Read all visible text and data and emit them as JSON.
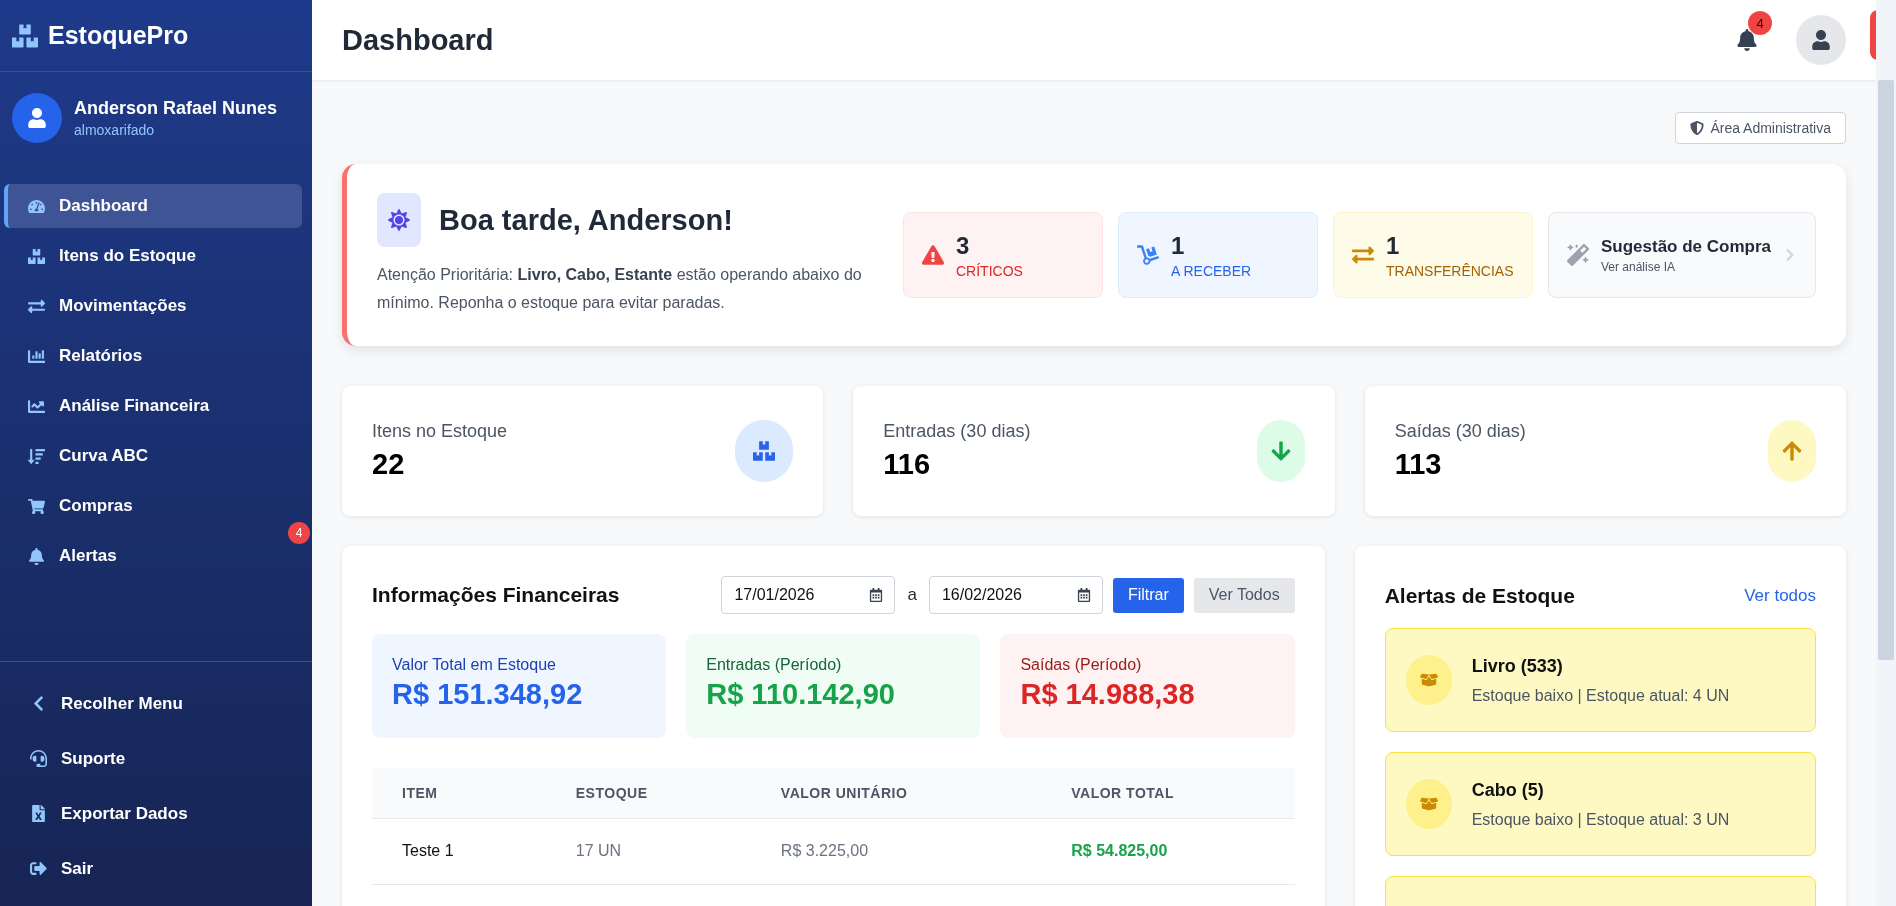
{
  "sidebar": {
    "brand": "EstoquePro",
    "user": {
      "name": "Anderson Rafael Nunes",
      "role": "almoxarifado"
    },
    "nav": [
      {
        "label": "Dashboard",
        "selected": true
      },
      {
        "label": "Itens do Estoque",
        "selected": false
      },
      {
        "label": "Movimentações",
        "selected": false
      },
      {
        "label": "Relatórios",
        "selected": false
      },
      {
        "label": "Análise Financeira",
        "selected": false
      },
      {
        "label": "Curva ABC",
        "selected": false
      },
      {
        "label": "Compras",
        "selected": false
      },
      {
        "label": "Alertas",
        "selected": false,
        "badge": "4"
      }
    ],
    "footer": [
      "Recolher Menu",
      "Suporte",
      "Exportar Dados",
      "Sair"
    ]
  },
  "header": {
    "title": "Dashboard",
    "notifications": "4"
  },
  "admin_button": "Área Administrativa",
  "greeting": {
    "title": "Boa tarde, Anderson!",
    "message": "Atenção Prioritária: **Livro, Cabo, Estante** estão operando abaixo do mínimo. Reponha o estoque para evitar paradas.",
    "tiles": [
      {
        "kind": "critical",
        "value": "3",
        "label": "CRÍTICOS"
      },
      {
        "kind": "receive",
        "value": "1",
        "label": "A RECEBER"
      },
      {
        "kind": "transfer",
        "value": "1",
        "label": "TRANSFERÊNCIAS"
      },
      {
        "kind": "suggestion",
        "value": "Sugestão de Compra",
        "label": "Ver análise IA"
      }
    ]
  },
  "stats": [
    {
      "kind": "items",
      "label": "Itens no Estoque",
      "value": "22"
    },
    {
      "kind": "in",
      "label": "Entradas (30 dias)",
      "value": "116"
    },
    {
      "kind": "out",
      "label": "Saídas (30 dias)",
      "value": "113"
    }
  ],
  "financial": {
    "title": "Informações Financeiras",
    "date_from": "17/01/2026",
    "separator": "a",
    "date_to": "16/02/2026",
    "filter_button": "Filtrar",
    "all_button": "Ver Todos",
    "summary": [
      {
        "kind": "stock",
        "label": "Valor Total em Estoque",
        "value": "R$ 151.348,92"
      },
      {
        "kind": "in",
        "label": "Entradas (Período)",
        "value": "R$ 110.142,90"
      },
      {
        "kind": "out",
        "label": "Saídas (Período)",
        "value": "R$ 14.988,38"
      }
    ],
    "table": {
      "columns": [
        "ITEM",
        "ESTOQUE",
        "VALOR UNITÁRIO",
        "VALOR TOTAL"
      ],
      "rows": [
        [
          "Teste 1",
          "17 UN",
          "R$ 3.225,00",
          "R$ 54.825,00"
        ]
      ]
    }
  },
  "alerts": {
    "title": "Alertas de Estoque",
    "link": "Ver todos",
    "items": [
      {
        "title": "Livro (533)",
        "detail": "Estoque baixo | Estoque atual: 4 UN"
      },
      {
        "title": "Cabo (5)",
        "detail": "Estoque baixo | Estoque atual: 3 UN"
      },
      {
        "kind": "cut"
      }
    ]
  }
}
